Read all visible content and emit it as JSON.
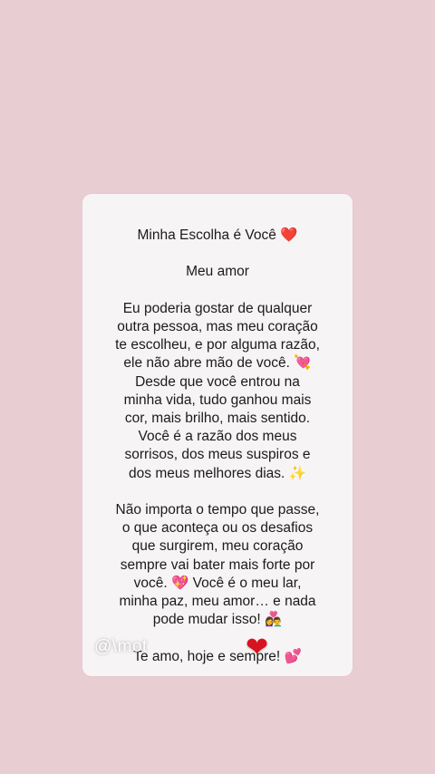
{
  "card": {
    "title": "Minha Escolha é Você",
    "title_emoji": "❤️",
    "salutation": "Meu amor",
    "paragraph1": [
      "Eu poderia gostar de qualquer",
      "outra pessoa, mas meu coração",
      "te escolheu, e por alguma razão,",
      "ele não abre mão de você.",
      "Desde que você entrou na",
      "minha vida, tudo ganhou mais",
      "cor, mais brilho, mais sentido.",
      "Você é a razão dos meus",
      "sorrisos, dos meus suspiros e",
      "dos meus melhores dias."
    ],
    "p1_emoji_a": "💘",
    "p1_emoji_b": "✨",
    "paragraph2": [
      "Não importa o tempo que passe,",
      "o que aconteça ou os desafios",
      "que surgirem, meu coração",
      "sempre vai bater mais forte por",
      "você.",
      "Você é o meu lar,",
      "minha paz, meu amor… e nada",
      "pode mudar isso!"
    ],
    "p2_emoji_a": "💖",
    "p2_emoji_b": "👩‍❤️‍👨",
    "closing": "Te amo, hoje e sempre!",
    "closing_emoji": "💕"
  },
  "overlay": {
    "watermark": "@\\mot",
    "sticker": "❤"
  },
  "colors": {
    "background": "#e8cdd3",
    "card": "#f7f4f5",
    "text": "#1b1b1b"
  }
}
